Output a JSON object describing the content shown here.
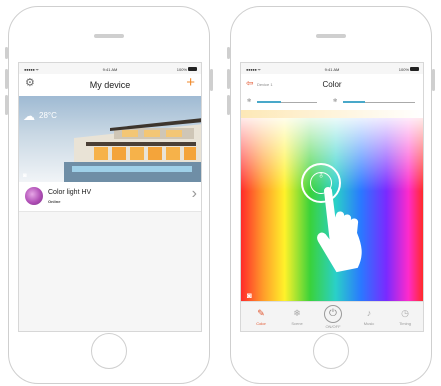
{
  "left_screen": {
    "status_bar": {
      "carrier": "●●●●● ᯤ",
      "time": "9:41 AM",
      "battery": "100%"
    },
    "nav": {
      "settings_icon": "gear-icon",
      "title": "My device",
      "add_icon": "plus-icon"
    },
    "hero": {
      "temperature": "28°C",
      "weather_icon": "partly-cloudy-icon"
    },
    "device": {
      "name": "Color light HV",
      "status": "Online"
    }
  },
  "right_screen": {
    "status_bar": {
      "carrier": "●●●●● ᯤ",
      "time": "9:41 AM",
      "battery": "100%"
    },
    "nav": {
      "back_icon": "exit-icon",
      "device_label": "Device 1",
      "title": "Color"
    },
    "sliders": [
      {
        "name": "brightness",
        "value": 0.4
      },
      {
        "name": "saturation",
        "value": 0.3
      }
    ],
    "tabs": [
      {
        "label": "Color",
        "icon": "palette-icon",
        "active": true
      },
      {
        "label": "Scene",
        "icon": "snowflake-icon",
        "active": false
      },
      {
        "label": "ON/OFF",
        "icon": "power-icon",
        "active": false
      },
      {
        "label": "Music",
        "icon": "music-icon",
        "active": false
      },
      {
        "label": "Timing",
        "icon": "clock-icon",
        "active": false
      }
    ]
  },
  "colors": {
    "accent": "#e2532b",
    "plus": "#f08a2b",
    "slider": "#49a8c9"
  }
}
